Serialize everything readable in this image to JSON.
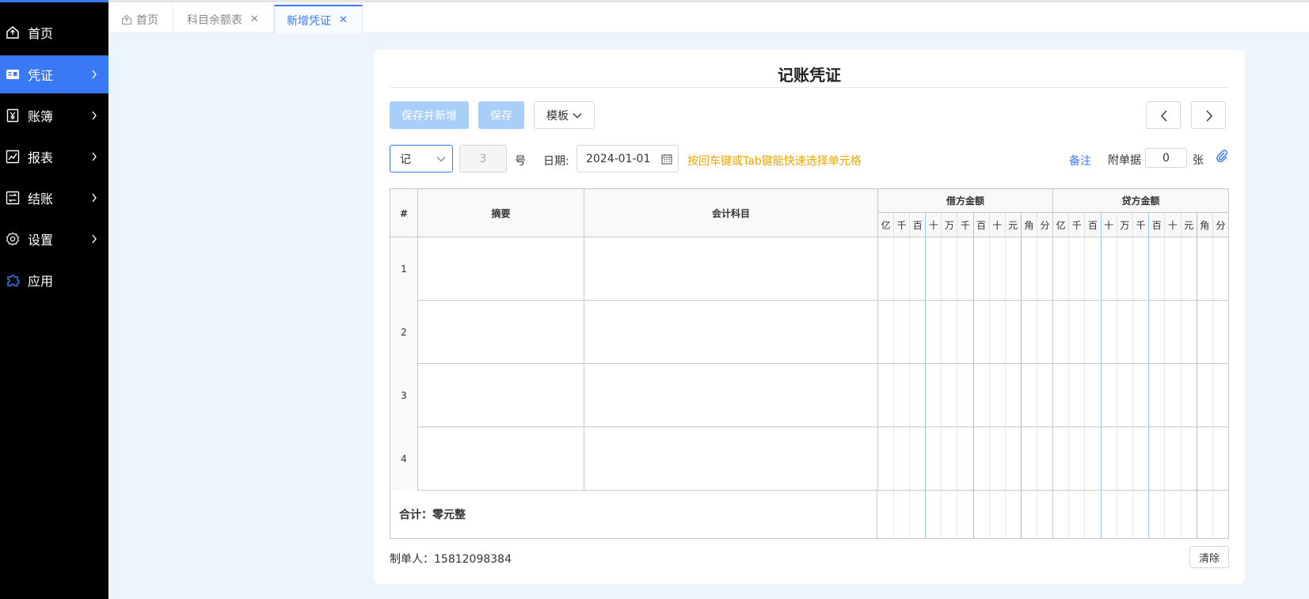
{
  "sidebar": {
    "items": [
      {
        "label": "首页",
        "icon": "home-icon"
      },
      {
        "label": "凭证",
        "icon": "voucher-icon",
        "active": true
      },
      {
        "label": "账簿",
        "icon": "ledger-icon"
      },
      {
        "label": "报表",
        "icon": "report-chart-icon"
      },
      {
        "label": "结账",
        "icon": "closing-icon"
      },
      {
        "label": "设置",
        "icon": "gear-icon"
      },
      {
        "label": "应用",
        "icon": "puzzle-icon"
      }
    ]
  },
  "tabs": [
    {
      "label": "首页",
      "closable": false
    },
    {
      "label": "科目余额表",
      "closable": true
    },
    {
      "label": "新增凭证",
      "closable": true,
      "active": true
    }
  ],
  "voucher": {
    "title": "记账凭证",
    "buttons": {
      "save_and_new": "保存并新增",
      "save": "保存",
      "template": "模板"
    },
    "type_value": "记",
    "number_value": "3",
    "number_suffix": "号",
    "date_label": "日期:",
    "date_value": "2024-01-01",
    "hint": "按回车键或Tab键能快速选择单元格",
    "remark_link": "备注",
    "attachments_label": "附单据",
    "attachments_value": "0",
    "attachments_unit": "张",
    "table": {
      "headers": {
        "index": "#",
        "summary": "摘要",
        "account": "会计科目",
        "debit": "借方金额",
        "credit": "贷方金额"
      },
      "digit_units": [
        "亿",
        "千",
        "百",
        "十",
        "万",
        "千",
        "百",
        "十",
        "元",
        "角",
        "分"
      ],
      "rows": [
        "1",
        "2",
        "3",
        "4"
      ],
      "total_label": "合计：零元整"
    },
    "maker_label": "制单人：15812098384",
    "clear_button": "清除"
  },
  "colors": {
    "accent": "#3a79f5",
    "sidebar_bg": "#000000",
    "page_bg": "#eef4fd",
    "hint": "#f0a400",
    "disabled_primary": "#a8cff7"
  }
}
